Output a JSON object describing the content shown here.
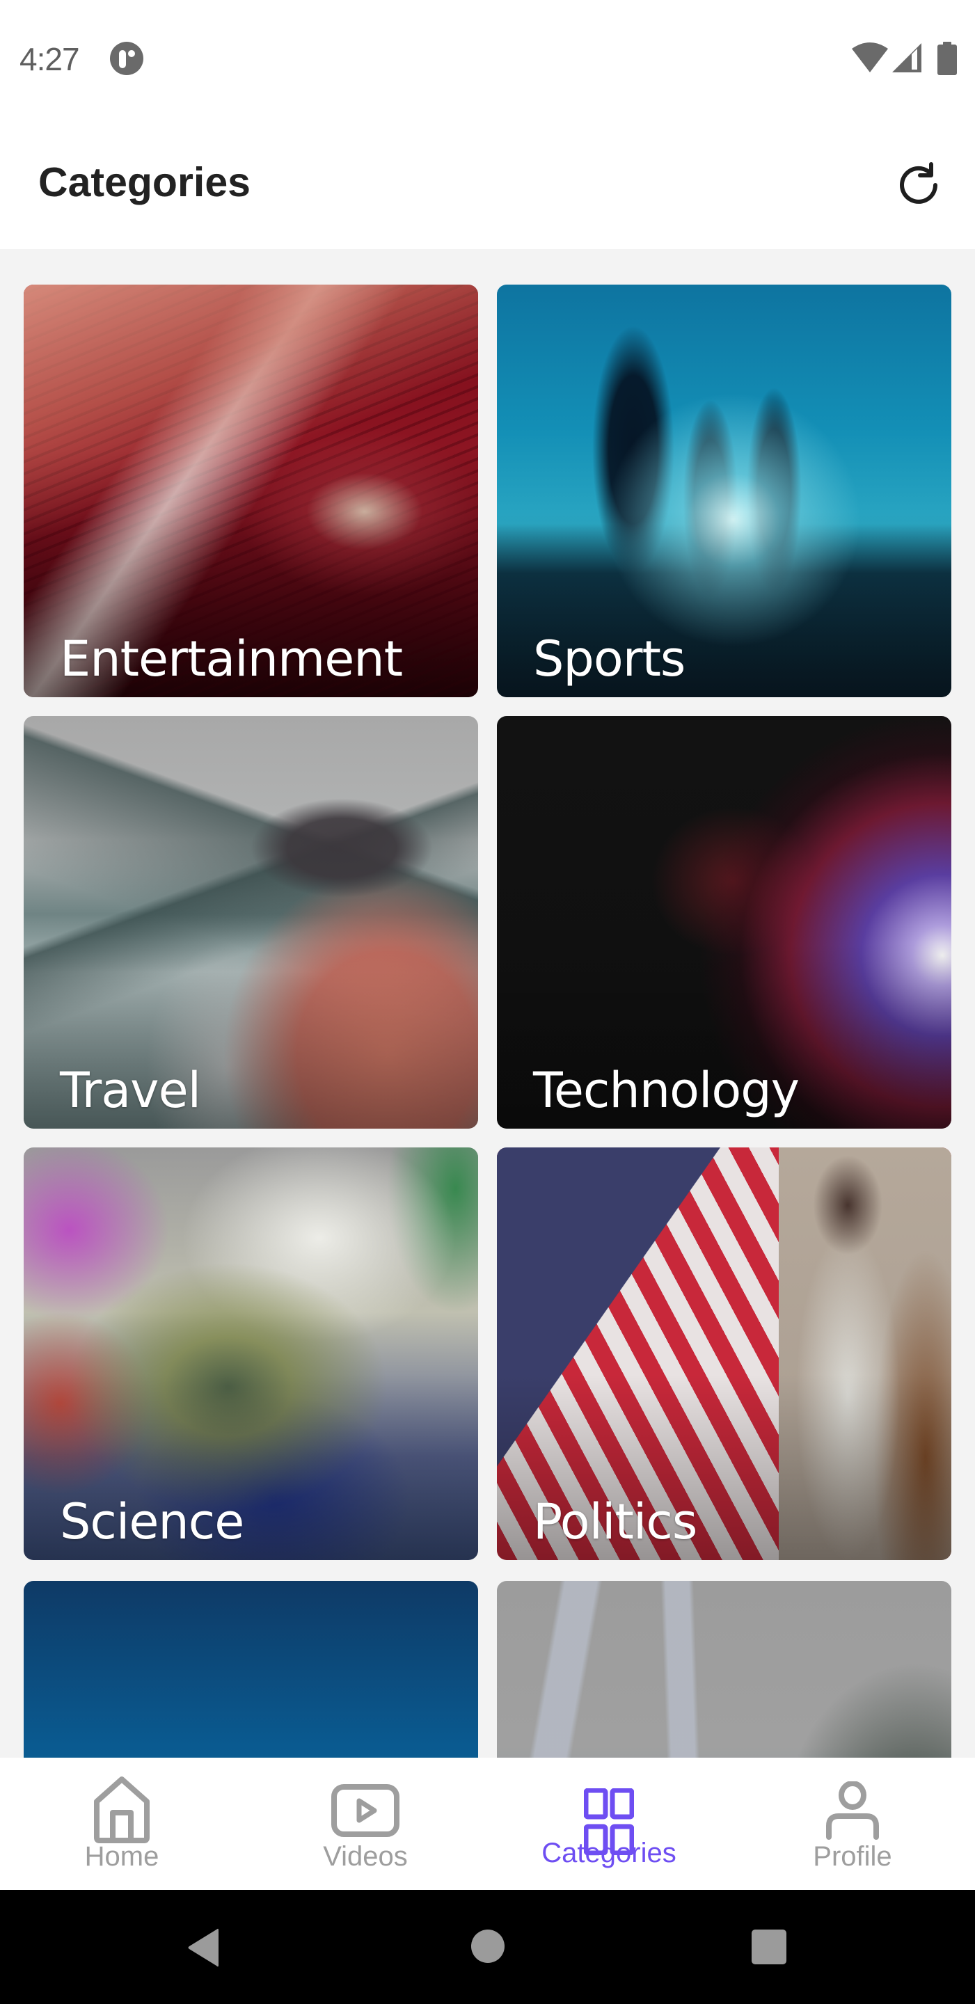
{
  "status_bar": {
    "time": "4:27",
    "icons": [
      "app-notification-icon",
      "wifi-icon",
      "cell-signal-icon",
      "battery-icon"
    ]
  },
  "header": {
    "title": "Categories",
    "refresh_icon": "refresh-icon"
  },
  "categories": [
    {
      "label": "Entertainment",
      "image": "projector-red"
    },
    {
      "label": "Sports",
      "image": "runners-silhouette-blue"
    },
    {
      "label": "Travel",
      "image": "hiker-lake-mountains"
    },
    {
      "label": "Technology",
      "image": "plasma-ball-dark"
    },
    {
      "label": "Science",
      "image": "ferrofluid-spikes"
    },
    {
      "label": "Politics",
      "image": "american-flag"
    },
    {
      "label": "",
      "image": "blue-sky"
    },
    {
      "label": "",
      "image": "woman-stretching"
    }
  ],
  "bottom_nav": {
    "items": [
      {
        "label": "Home",
        "icon": "home-icon",
        "active": false
      },
      {
        "label": "Videos",
        "icon": "video-play-icon",
        "active": false
      },
      {
        "label": "Categories",
        "icon": "grid-icon",
        "active": true
      },
      {
        "label": "Profile",
        "icon": "profile-icon",
        "active": false
      }
    ]
  },
  "system_nav": {
    "buttons": [
      "back",
      "home",
      "recents"
    ]
  },
  "colors": {
    "accent": "#6e4ef2",
    "inactive": "#9e9e9e",
    "title": "#222222",
    "background": "#f3f3f3"
  }
}
